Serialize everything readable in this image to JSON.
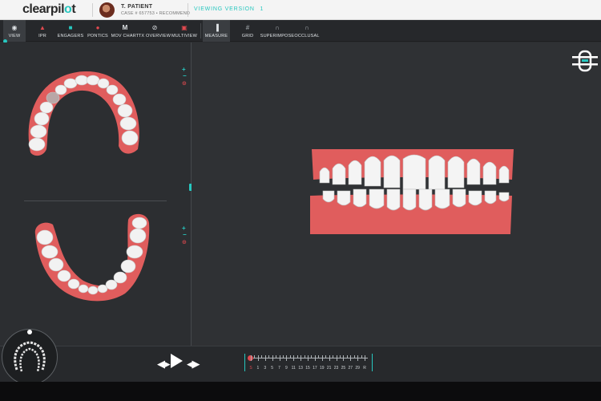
{
  "header": {
    "logo_text": "clearpil",
    "logo_accent": "o",
    "logo_tail": "t",
    "patient_name": "T. PATIENT",
    "case_info": "CASE # 657753 • RECOMMEND",
    "version_label": "VIEWING VERSION",
    "version_number": "1"
  },
  "toolbar": {
    "items": [
      {
        "label": "VIEW",
        "icon": "eye-icon"
      },
      {
        "label": "IPR",
        "icon": "triangle-icon"
      },
      {
        "label": "ENGAGERS",
        "icon": "square-icon"
      },
      {
        "label": "PONTICS",
        "icon": "tooth-icon"
      },
      {
        "label": "MOV CHART",
        "icon": "m-icon"
      },
      {
        "label": "TX OVERVIEW",
        "icon": "link-icon"
      },
      {
        "label": "MULTIVIEW",
        "icon": "multiview-icon"
      },
      {
        "label": "MEASURE",
        "icon": "ruler-icon"
      },
      {
        "label": "GRID",
        "icon": "grid-icon"
      },
      {
        "label": "SUPERIMPOSE",
        "icon": "arch-icon"
      },
      {
        "label": "OCCLUSAL",
        "icon": "arch-small-icon"
      }
    ]
  },
  "controls": {
    "plus": "+",
    "minus": "−"
  },
  "timeline": {
    "stages": [
      "S",
      "1",
      "3",
      "5",
      "7",
      "9",
      "11",
      "13",
      "15",
      "17",
      "19",
      "21",
      "23",
      "25",
      "27",
      "29",
      "R"
    ],
    "current_index": 0
  },
  "colors": {
    "accent": "#27c7bf",
    "gum": "#e05d5d",
    "marker": "#e0494f"
  }
}
